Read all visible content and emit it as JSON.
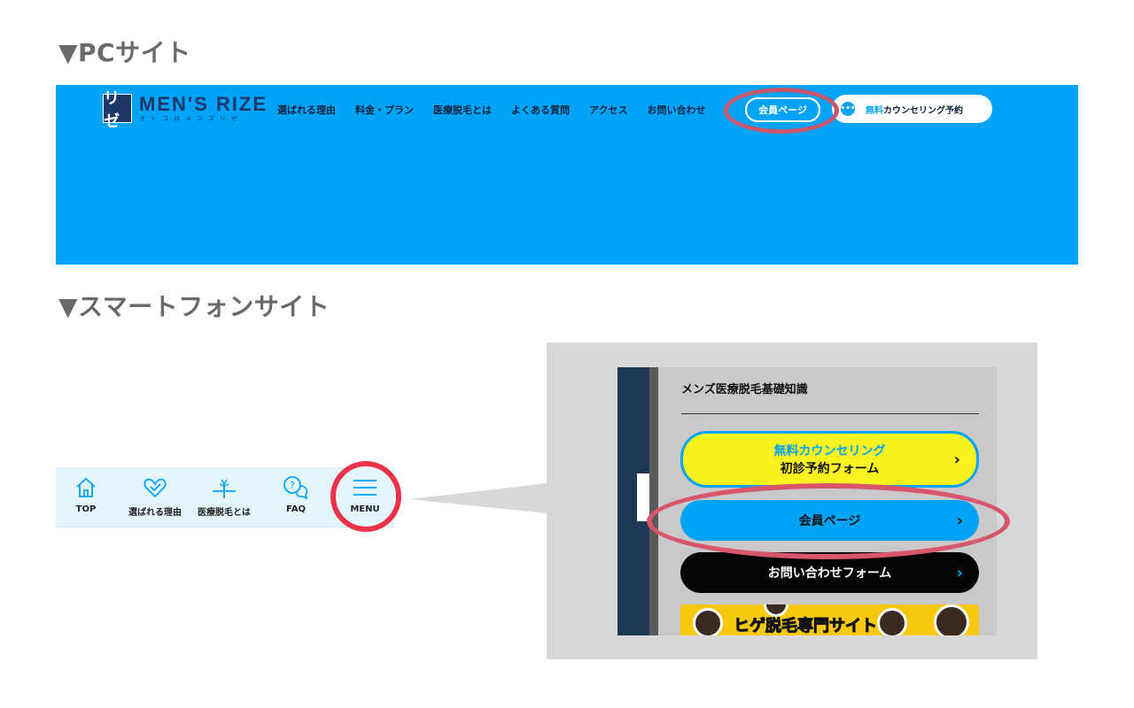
{
  "headings": {
    "pc": "▼PCサイト",
    "smartphone": "▼スマートフォンサイト"
  },
  "pc_site": {
    "logo_mark": "リゼ",
    "logo_main": "MEN'S RIZE",
    "logo_sub": "オトコはメンズリゼ",
    "nav": [
      "選ばれる理由",
      "料金・プラン",
      "医療脱毛とは",
      "よくある質問",
      "アクセス",
      "お問い合わせ"
    ],
    "member_button": "会員ページ",
    "counsel_free": "無料",
    "counsel_rest": "カウンセリング予約",
    "chat_icon": "chat-bubble-icon"
  },
  "sp_nav": {
    "items": [
      {
        "label": "TOP",
        "icon": "home-icon"
      },
      {
        "label": "選ばれる理由",
        "icon": "heart-check-icon"
      },
      {
        "label": "医療脱毛とは",
        "icon": "hair-laser-icon"
      },
      {
        "label": "FAQ",
        "icon": "question-bubble-icon"
      },
      {
        "label": "MENU",
        "icon": "hamburger-icon"
      }
    ]
  },
  "sp_menu": {
    "heading": "メンズ医療脱毛基礎知識",
    "counsel_line1": "無料カウンセリング",
    "counsel_line2": "初診予約フォーム",
    "member": "会員ページ",
    "contact": "お問い合わせフォーム",
    "banner": "ヒゲ脱毛専門サイト"
  },
  "colors": {
    "brand_blue": "#00a3f5",
    "navy": "#1d3768",
    "highlight_ring": "#c8556b",
    "sp_ring": "#ea3349",
    "yellow": "#fbf31f"
  }
}
